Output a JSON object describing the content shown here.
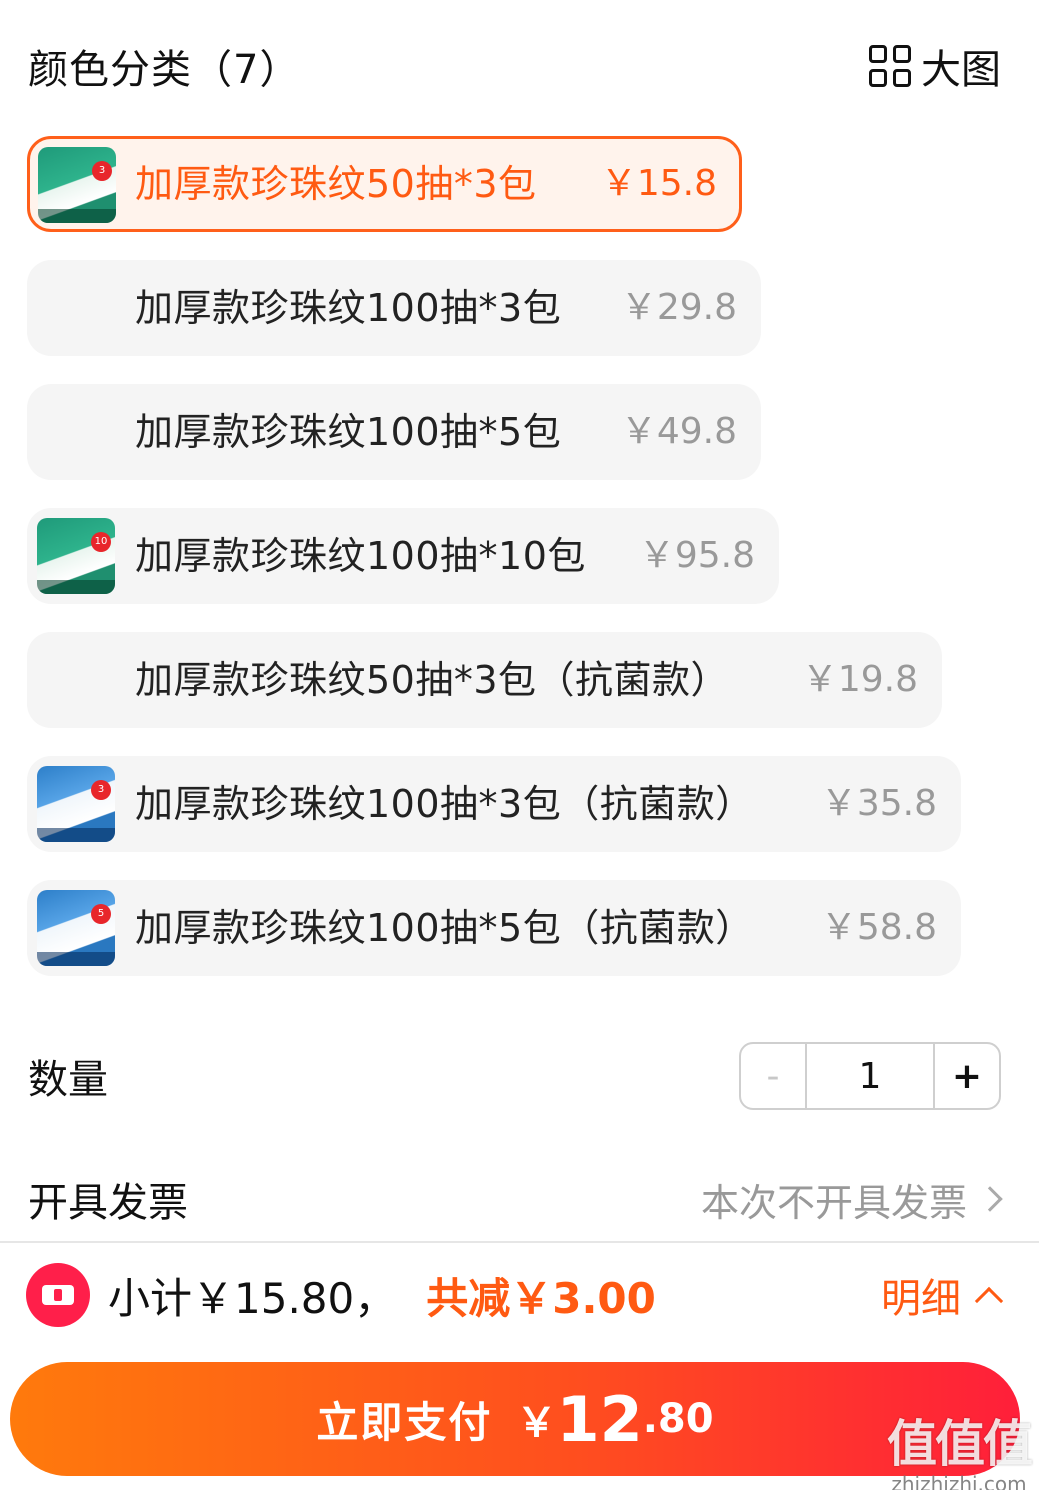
{
  "header": {
    "title": "颜色分类（7）",
    "big_view_label": "大图"
  },
  "options": [
    {
      "label": "加厚款珍珠纹50抽*3包",
      "price": "￥15.8",
      "selected": true,
      "thumb": "green"
    },
    {
      "label": "加厚款珍珠纹100抽*3包",
      "price": "￥29.8",
      "selected": false,
      "thumb": ""
    },
    {
      "label": "加厚款珍珠纹100抽*5包",
      "price": "￥49.8",
      "selected": false,
      "thumb": ""
    },
    {
      "label": "加厚款珍珠纹100抽*10包",
      "price": "￥95.8",
      "selected": false,
      "thumb": "green"
    },
    {
      "label": "加厚款珍珠纹50抽*3包（抗菌款）",
      "price": "￥19.8",
      "selected": false,
      "thumb": ""
    },
    {
      "label": "加厚款珍珠纹100抽*3包（抗菌款）",
      "price": "￥35.8",
      "selected": false,
      "thumb": "blue"
    },
    {
      "label": "加厚款珍珠纹100抽*5包（抗菌款）",
      "price": "￥58.8",
      "selected": false,
      "thumb": "blue"
    }
  ],
  "quantity": {
    "label": "数量",
    "minus": "-",
    "value": "1",
    "plus": "+"
  },
  "invoice": {
    "label": "开具发票",
    "value": "本次不开具发票"
  },
  "summary": {
    "subtotal": "小计￥15.80，",
    "discount": "共减￥3.00",
    "detail": "明细"
  },
  "pay": {
    "label": "立即支付",
    "currency": "￥",
    "amount_int": "12",
    "amount_dec": ".80"
  },
  "watermark": {
    "main": "值值值",
    "sub": "zhizhizhi.com"
  },
  "colors": {
    "accent": "#ff5a12",
    "selected_bg": "#fff3ec",
    "option_bg": "#f5f5f5",
    "pay_gradient_start": "#ff7a0c",
    "pay_gradient_end": "#ff1f3a",
    "coupon": "#ff1f4a"
  },
  "icons": {
    "big_view": "grid-icon",
    "invoice_arrow": "chevron-right-icon",
    "detail_arrow": "chevron-up-icon",
    "coupon": "coupon-icon"
  }
}
